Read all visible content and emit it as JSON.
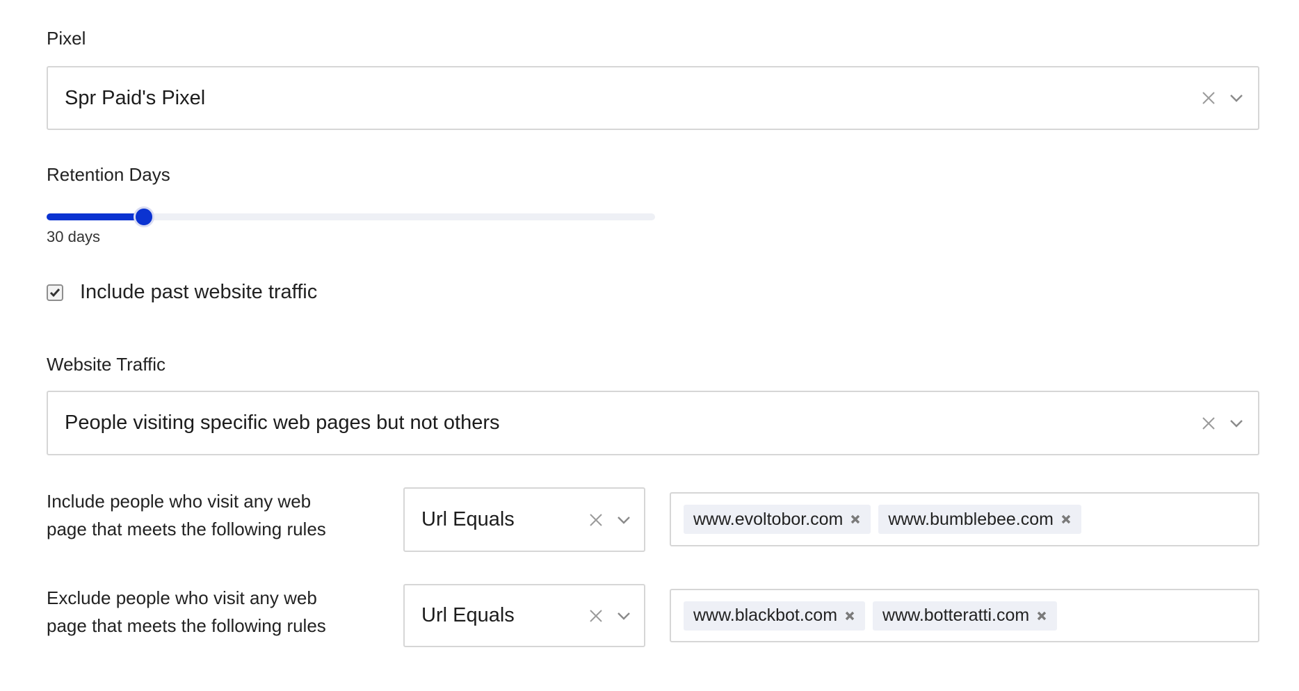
{
  "pixel": {
    "label": "Pixel",
    "value": "Spr Paid's Pixel"
  },
  "retention": {
    "label": "Retention Days",
    "value_text": "30 days",
    "fraction": 0.16
  },
  "past_traffic": {
    "label": "Include past website traffic",
    "checked": true
  },
  "website_traffic": {
    "label": "Website Traffic",
    "value": "People visiting specific web pages but not others"
  },
  "include_rule": {
    "label_line1": "Include people who visit any web",
    "label_line2": "page that meets the following rules",
    "operator": "Url Equals",
    "tags": [
      "www.evoltobor.com",
      "www.bumblebee.com"
    ]
  },
  "exclude_rule": {
    "label_line1": "Exclude people who visit any web",
    "label_line2": "page that meets the following rules",
    "operator": "Url Equals",
    "tags": [
      "www.blackbot.com",
      "www.botteratti.com"
    ]
  },
  "icons": {
    "clear": "close-icon",
    "dropdown": "chevron-down-icon",
    "tag_remove": "remove-tag-icon",
    "check": "checkmark-icon"
  },
  "colors": {
    "accent": "#0b33d1",
    "border": "#d6d6d6",
    "tag_bg": "#eef0f6"
  }
}
